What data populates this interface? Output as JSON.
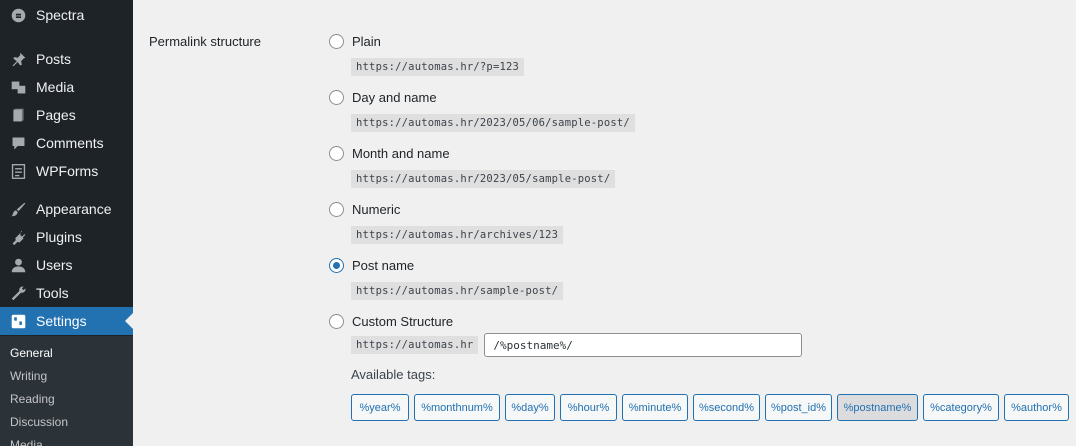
{
  "sidebar": {
    "items": [
      {
        "label": "Spectra",
        "icon": "spectra-logo-icon"
      },
      {
        "label": "Posts",
        "icon": "pin-icon"
      },
      {
        "label": "Media",
        "icon": "media-icon"
      },
      {
        "label": "Pages",
        "icon": "pages-icon"
      },
      {
        "label": "Comments",
        "icon": "comment-icon"
      },
      {
        "label": "WPForms",
        "icon": "forms-icon"
      },
      {
        "label": "Appearance",
        "icon": "brush-icon"
      },
      {
        "label": "Plugins",
        "icon": "plug-icon"
      },
      {
        "label": "Users",
        "icon": "users-icon"
      },
      {
        "label": "Tools",
        "icon": "wrench-icon"
      },
      {
        "label": "Settings",
        "icon": "settings-icon"
      }
    ],
    "submenu": [
      "General",
      "Writing",
      "Reading",
      "Discussion",
      "Media"
    ]
  },
  "permalink": {
    "field_label": "Permalink structure",
    "options": [
      {
        "label": "Plain",
        "example": "https://automas.hr/?p=123",
        "checked": false
      },
      {
        "label": "Day and name",
        "example": "https://automas.hr/2023/05/06/sample-post/",
        "checked": false
      },
      {
        "label": "Month and name",
        "example": "https://automas.hr/2023/05/sample-post/",
        "checked": false
      },
      {
        "label": "Numeric",
        "example": "https://automas.hr/archives/123",
        "checked": false
      },
      {
        "label": "Post name",
        "example": "https://automas.hr/sample-post/",
        "checked": true
      },
      {
        "label": "Custom Structure",
        "checked": false
      }
    ],
    "custom_prefix": "https://automas.hr",
    "custom_value": "/%postname%/",
    "available_tags_label": "Available tags:",
    "tags": [
      "%year%",
      "%monthnum%",
      "%day%",
      "%hour%",
      "%minute%",
      "%second%",
      "%post_id%",
      "%postname%",
      "%category%",
      "%author%"
    ],
    "active_tag": "%postname%"
  },
  "colors": {
    "accent": "#2271b1",
    "sidebar_bg": "#1d2327",
    "page_bg": "#f0f0f1"
  }
}
